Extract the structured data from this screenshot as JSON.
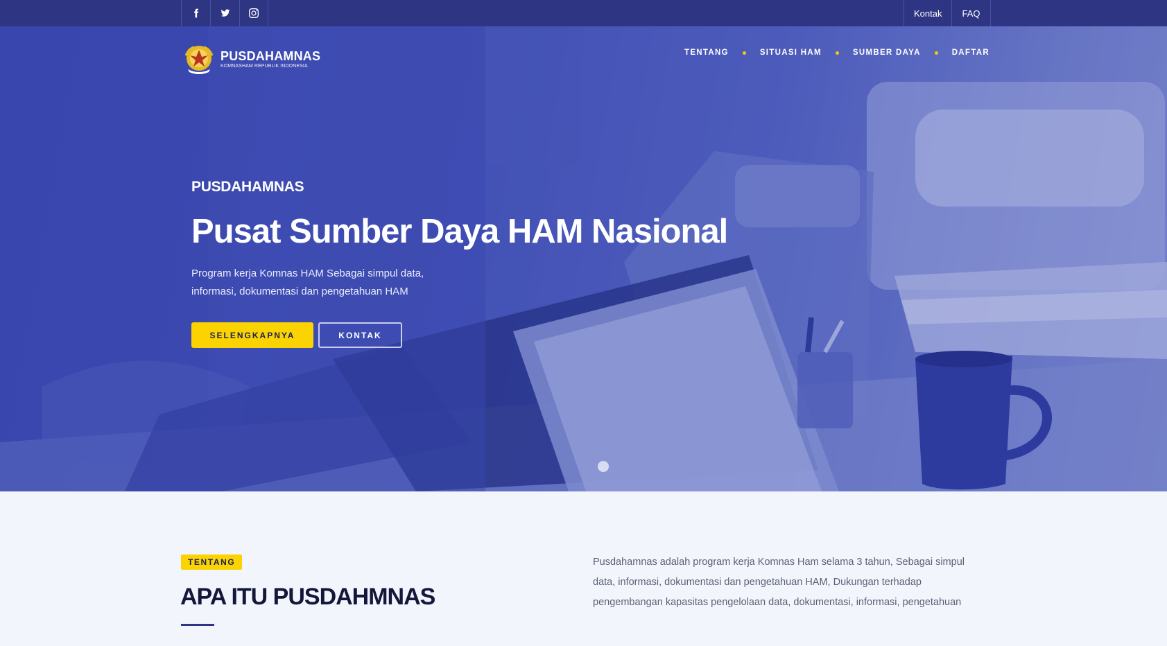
{
  "topbar": {
    "social": [
      {
        "icon": "facebook-icon"
      },
      {
        "icon": "twitter-icon"
      },
      {
        "icon": "instagram-icon"
      }
    ],
    "links": [
      "Kontak",
      "FAQ"
    ]
  },
  "brand": {
    "name": "PUSDAHAMNAS",
    "subtitle": "KOMNASHAM REPUBLIK INDONESIA"
  },
  "nav": {
    "items": [
      "TENTANG",
      "SITUASI HAM",
      "SUMBER DAYA",
      "DAFTAR"
    ]
  },
  "hero": {
    "eyebrow": "PUSDAHAMNAS",
    "title": "Pusat Sumber Daya HAM Nasional",
    "description": "Program kerja Komnas HAM Sebagai simpul data, informasi, dokumentasi dan pengetahuan HAM",
    "primary_button": "SELENGKAPNYA",
    "secondary_button": "KONTAK"
  },
  "about": {
    "tag": "TENTANG",
    "title": "APA ITU PUSDAHMNAS",
    "text": "Pusdahamnas adalah program kerja Komnas Ham selama 3 tahun, Sebagai simpul data, informasi, dokumentasi dan pengetahuan HAM, Dukungan terhadap pengembangan kapasitas pengelolaan data, dokumentasi, informasi, pengetahuan"
  },
  "colors": {
    "topbar": "#2e3582",
    "accent": "#fbd300",
    "hero_overlay": "#3b48b0",
    "heading_dark": "#14173a"
  }
}
